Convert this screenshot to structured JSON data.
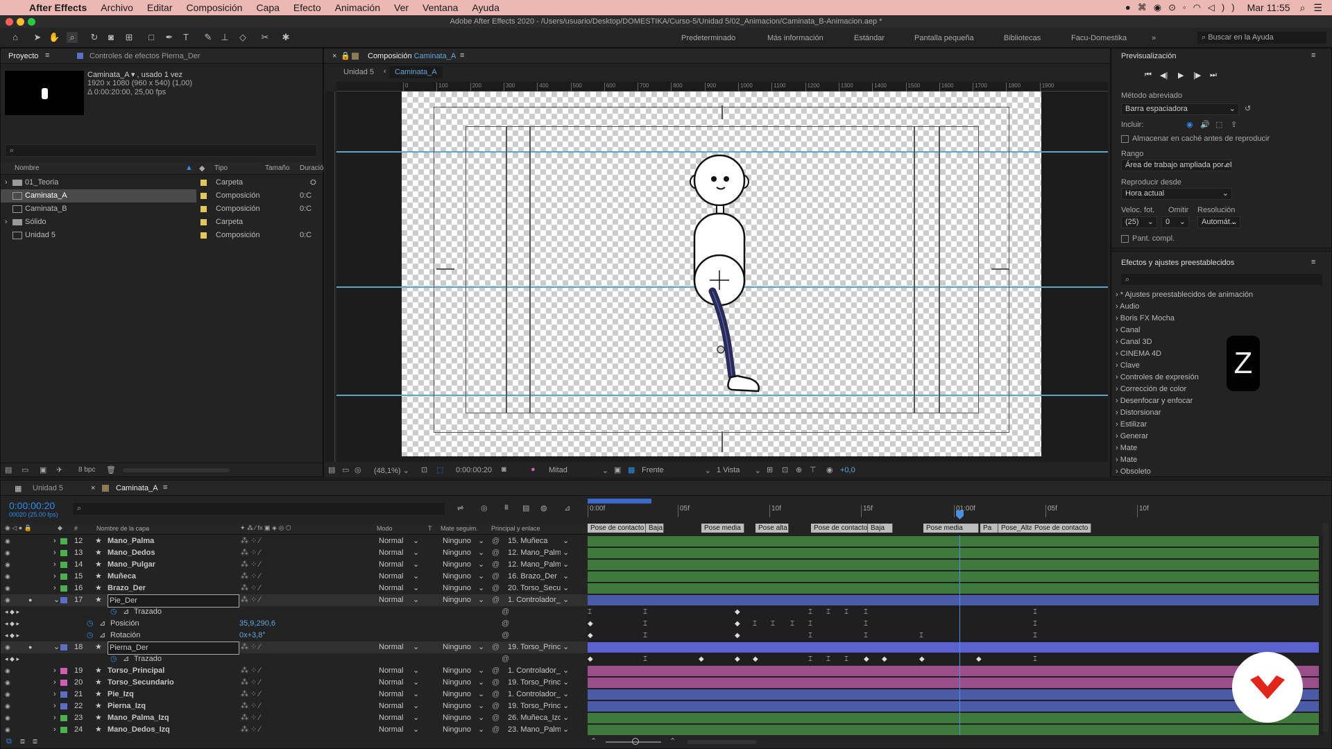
{
  "menubar": {
    "app": "After Effects",
    "items": [
      "Archivo",
      "Editar",
      "Composición",
      "Capa",
      "Efecto",
      "Animación",
      "Ver",
      "Ventana",
      "Ayuda"
    ],
    "clock": "Mar 11:55"
  },
  "window": {
    "title": "Adobe After Effects 2020 - /Users/usuario/Desktop/DOMESTIKA/Curso-5/Unidad 5/02_Animacion/Caminata_B-Animacion.aep *"
  },
  "workspaces": [
    "Predeterminado",
    "Más información",
    "Estándar",
    "Pantalla pequeña",
    "Bibliotecas",
    "Facu-Domestika"
  ],
  "help_search": "Buscar en la Ayuda",
  "project": {
    "tab": "Proyecto",
    "tab2": "Controles de efectos Pierna_Der",
    "comp_name": "Caminata_A ▾ , usado 1 vez",
    "comp_res": "1920 x 1080  (960 x 540) (1,00)",
    "comp_dur": "Δ 0:00:20:00, 25,00 fps",
    "cols": {
      "name": "Nombre",
      "type": "Tipo",
      "size": "Tamaño",
      "dur": "Duració"
    },
    "items": [
      {
        "name": "01_Teoria",
        "type": "Carpeta",
        "dur": ""
      },
      {
        "name": "Caminata_A",
        "type": "Composición",
        "dur": "0:C"
      },
      {
        "name": "Caminata_B",
        "type": "Composición",
        "dur": "0:C"
      },
      {
        "name": "Sólido",
        "type": "Carpeta",
        "dur": ""
      },
      {
        "name": "Unidad 5",
        "type": "Composición",
        "dur": "0:C"
      }
    ],
    "bpc": "8 bpc"
  },
  "comp": {
    "tab": "Composición",
    "tab_name": "Caminata_A",
    "crumb1": "Unidad 5",
    "crumb2": "Caminata_A",
    "zoom": "(48,1%)",
    "time": "0:00:00:20",
    "res": "Mitad",
    "view": "Frente",
    "views": "1 Vista",
    "exposure": "+0,0",
    "ruler": [
      "0",
      "100",
      "200",
      "300",
      "400",
      "500",
      "600",
      "700",
      "800",
      "900",
      "1000",
      "1100",
      "1200",
      "1300",
      "1400",
      "1500",
      "1600",
      "1700",
      "1800",
      "1900"
    ]
  },
  "preview": {
    "title": "Previsualización",
    "shortcut_label": "Método abreviado",
    "shortcut": "Barra espaciadora",
    "include": "Incluir:",
    "cache": "Almacenar en caché antes de reproducir",
    "range_label": "Rango",
    "range": "Área de trabajo ampliada por el t...",
    "from_label": "Reproducir desde",
    "from": "Hora actual",
    "fps_label": "Veloc. fot.",
    "skip_label": "Omitir",
    "res_label": "Resolución",
    "fps": "(25)",
    "skip": "0",
    "res": "Automát...",
    "full": "Pant. compl."
  },
  "effects": {
    "title": "Efectos y ajustes preestablecidos",
    "items": [
      "* Ajustes preestablecidos de animación",
      "Audio",
      "Boris FX Mocha",
      "Canal",
      "Canal 3D",
      "CINEMA 4D",
      "Clave",
      "Controles de expresión",
      "Corrección de color",
      "Desenfocar y enfocar",
      "Distorsionar",
      "Estilizar",
      "Generar",
      "Mate",
      "Mate",
      "Obsoleto"
    ]
  },
  "key_overlay": "Z",
  "timeline": {
    "tab1": "Unidad 5",
    "tab2": "Caminata_A",
    "time": "0:00:00:20",
    "fps": "00020 (25.00 fps)",
    "cols": {
      "name": "Nombre de la capa",
      "mode": "Modo",
      "t": "T",
      "matte": "Mate seguim.",
      "parent": "Principal y enlace"
    },
    "ruler": [
      "0:00f",
      "05f",
      "10f",
      "15f",
      "01:00f",
      "05f",
      "10f"
    ],
    "markers": [
      "Pose de contacto",
      "Baja",
      "Pose media",
      "Pose alta",
      "Pose de contacto",
      "Baja",
      "Pose media",
      "Pa",
      "Pose_Alta",
      "Pose de contacto"
    ],
    "layers": [
      {
        "n": "12",
        "name": "Mano_Palma",
        "mode": "Normal",
        "matte": "Ninguno",
        "parent": "15. Muñeca",
        "color": "#4caf50"
      },
      {
        "n": "13",
        "name": "Mano_Dedos",
        "mode": "Normal",
        "matte": "Ninguno",
        "parent": "12. Mano_Palm",
        "color": "#4caf50"
      },
      {
        "n": "14",
        "name": "Mano_Pulgar",
        "mode": "Normal",
        "matte": "Ninguno",
        "parent": "12. Mano_Palm",
        "color": "#4caf50"
      },
      {
        "n": "15",
        "name": "Muñeca",
        "mode": "Normal",
        "matte": "Ninguno",
        "parent": "16. Brazo_Der",
        "color": "#4caf50"
      },
      {
        "n": "16",
        "name": "Brazo_Der",
        "mode": "Normal",
        "matte": "Ninguno",
        "parent": "20. Torso_Secur",
        "color": "#4caf50"
      },
      {
        "n": "17",
        "name": "Pie_Der",
        "mode": "Normal",
        "matte": "Ninguno",
        "parent": "1. Controlador_",
        "color": "#5b6fc7"
      }
    ],
    "props17": [
      {
        "name": "Trazado",
        "val": ""
      },
      {
        "name": "Posición",
        "val": "35,9,290,6"
      },
      {
        "name": "Rotación",
        "val": "0x+3,8°"
      }
    ],
    "layer18": {
      "n": "18",
      "name": "Pierna_Der",
      "mode": "Normal",
      "matte": "Ninguno",
      "parent": "19. Torso_Princ",
      "prop": "Trazado"
    },
    "layers2": [
      {
        "n": "19",
        "name": "Torso_Principal",
        "mode": "Normal",
        "matte": "Ninguno",
        "parent": "1. Controlador_",
        "color": "#d05fb4"
      },
      {
        "n": "20",
        "name": "Torso_Secundario",
        "mode": "Normal",
        "matte": "Ninguno",
        "parent": "19. Torso_Princ",
        "color": "#d05fb4"
      },
      {
        "n": "21",
        "name": "Pie_Izq",
        "mode": "Normal",
        "matte": "Ninguno",
        "parent": "1. Controlador_",
        "color": "#5b6fc7"
      },
      {
        "n": "22",
        "name": "Pierna_Izq",
        "mode": "Normal",
        "matte": "Ninguno",
        "parent": "19. Torso_Princ",
        "color": "#5b6fc7"
      },
      {
        "n": "23",
        "name": "Mano_Palma_Izq",
        "mode": "Normal",
        "matte": "Ninguno",
        "parent": "26. Muñeca_Izq",
        "color": "#4caf50"
      },
      {
        "n": "24",
        "name": "Mano_Dedos_Izq",
        "mode": "Normal",
        "matte": "Ninguno",
        "parent": "23. Mano_Palm",
        "color": "#4caf50"
      }
    ]
  },
  "colors": {
    "accent": "#2d8ceb",
    "guide": "#5fa7c9",
    "track_green": "#3f7a3c",
    "track_purple": "#9a4f8a",
    "track_blue": "#4b5ba8"
  }
}
